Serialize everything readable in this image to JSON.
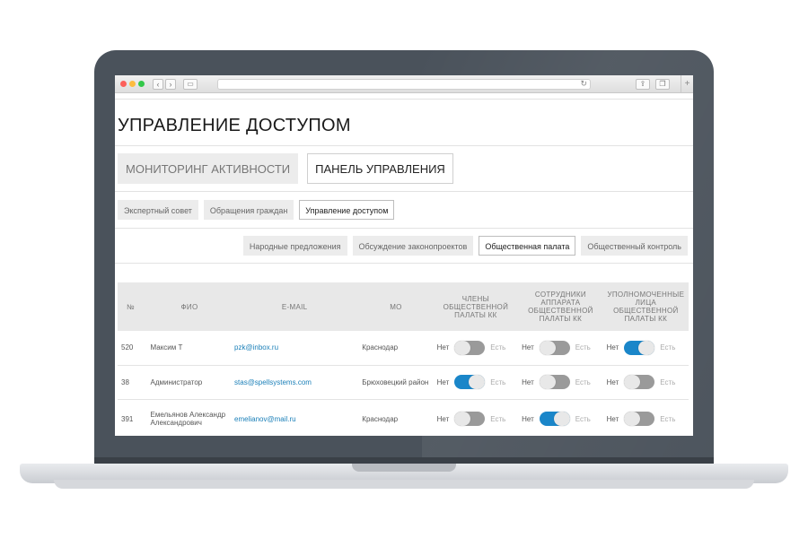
{
  "page": {
    "title": "УПРАВЛЕНИЕ ДОСТУПОМ"
  },
  "tabs_main": [
    {
      "label": "МОНИТОРИНГ АКТИВНОСТИ",
      "active": false
    },
    {
      "label": "ПАНЕЛЬ УПРАВЛЕНИЯ",
      "active": true
    }
  ],
  "tabs_sub": [
    {
      "label": "Экспертный совет",
      "active": false
    },
    {
      "label": "Обращения граждан",
      "active": false
    },
    {
      "label": "Управление доступом",
      "active": true
    }
  ],
  "tabs_section": [
    {
      "label": "Народные предложения",
      "active": false
    },
    {
      "label": "Обсуждение законопроектов",
      "active": false
    },
    {
      "label": "Общественная палата",
      "active": true
    },
    {
      "label": "Общественный контроль",
      "active": false
    }
  ],
  "table": {
    "headers": {
      "num": "№",
      "fio": "ФИО",
      "email": "E-MAIL",
      "mo": "МО",
      "col1": "ЧЛЕНЫ ОБЩЕСТВЕННОЙ ПАЛАТЫ КК",
      "col2": "СОТРУДНИКИ АППАРАТА ОБЩЕСТВЕННОЙ ПАЛАТЫ КК",
      "col3": "УПОЛНОМОЧЕННЫЕ ЛИЦА ОБЩЕСТВЕННОЙ ПАЛАТЫ КК"
    },
    "toggle_no": "Нет",
    "toggle_yes": "Есть",
    "rows": [
      {
        "num": "520",
        "fio": "Максим Т",
        "email": "pzk@inbox.ru",
        "mo": "Краснодар",
        "t1": false,
        "t2": false,
        "t3": true
      },
      {
        "num": "38",
        "fio": "Администратор",
        "email": "stas@spellsystems.com",
        "mo": "Брюховецкий район",
        "t1": true,
        "t2": false,
        "t3": false
      },
      {
        "num": "391",
        "fio": "Емельянов Александр Александрович",
        "email": "emelianov@mail.ru",
        "mo": "Краснодар",
        "t1": false,
        "t2": true,
        "t3": false
      }
    ]
  },
  "colors": {
    "accent": "#1a86c9",
    "link": "#1a7fb8"
  }
}
